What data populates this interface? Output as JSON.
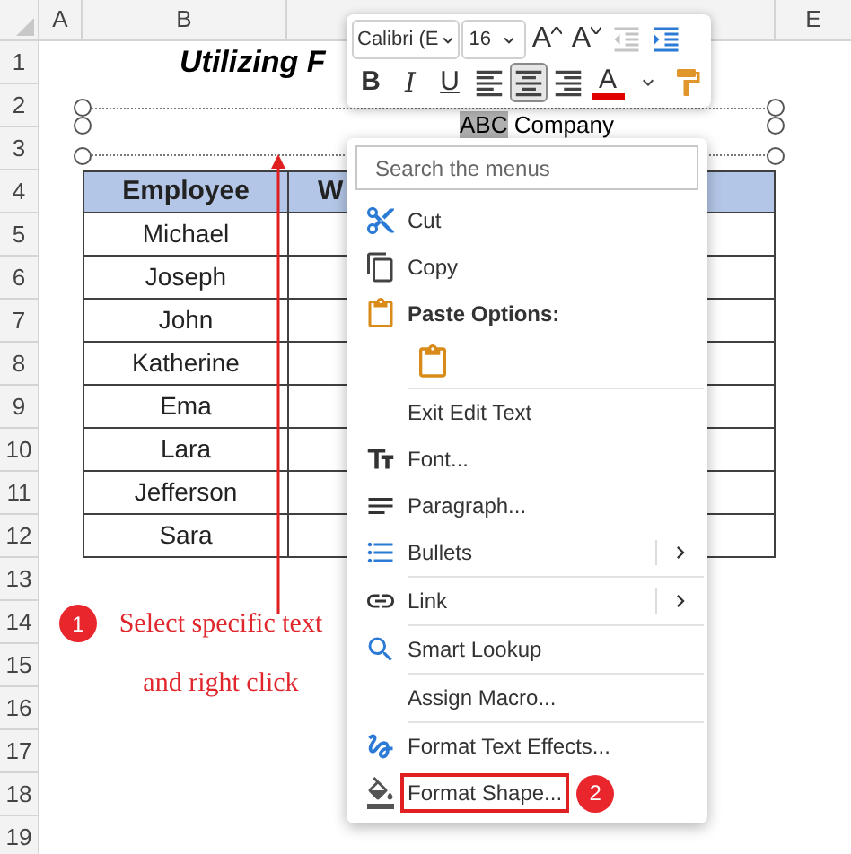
{
  "sheet": {
    "column_headers": [
      {
        "label": "A"
      },
      {
        "label": "B"
      },
      {
        "label": "E"
      }
    ],
    "row_headers": [
      "1",
      "2",
      "3",
      "4",
      "5",
      "6",
      "7",
      "8",
      "9",
      "10",
      "11",
      "12",
      "13",
      "14",
      "15",
      "16",
      "17",
      "18",
      "19"
    ],
    "title": "Utilizing F",
    "text_box": {
      "selected_text": "ABC",
      "rest_text": " Company"
    },
    "table": {
      "columns": [
        "Employee",
        "W"
      ],
      "rows": [
        "Michael",
        "Joseph",
        "John",
        "Katherine",
        "Ema",
        "Lara",
        "Jefferson",
        "Sara"
      ]
    }
  },
  "mini_toolbar": {
    "font": "Calibri (E",
    "size": "16",
    "row_1": [
      {
        "kind": "grow",
        "label": "A"
      },
      {
        "kind": "shrink",
        "label": "A"
      },
      {
        "kind": "indent-decrease",
        "disabled": true
      },
      {
        "kind": "indent-increase",
        "disabled": false
      }
    ],
    "row_2": [
      {
        "kind": "bold",
        "label": "B",
        "selected": false
      },
      {
        "kind": "italic",
        "label": "I",
        "selected": false
      },
      {
        "kind": "underline",
        "label": "U",
        "selected": false
      },
      {
        "kind": "align-left",
        "selected": false
      },
      {
        "kind": "align-center",
        "selected": true
      },
      {
        "kind": "align-right",
        "selected": false
      },
      {
        "kind": "font-color",
        "label": "A"
      },
      {
        "kind": "dropdown"
      },
      {
        "kind": "format-painter"
      }
    ]
  },
  "context_menu": {
    "search_placeholder": "Search the menus",
    "items": [
      {
        "kind": "cut",
        "label": "Cut",
        "separator_before": false,
        "submenu": false,
        "boxed": false
      },
      {
        "kind": "copy",
        "label": "Copy",
        "separator_before": false,
        "submenu": false,
        "boxed": false
      },
      {
        "kind": "paste-header",
        "label": "Paste Options:",
        "separator_before": false,
        "submenu": false,
        "boxed": false
      },
      {
        "kind": "paste-text",
        "separator_before": false
      },
      {
        "kind": "plain",
        "label": "Exit Edit Text",
        "separator_before": true,
        "submenu": false,
        "boxed": false
      },
      {
        "kind": "font",
        "label": "Font...",
        "separator_before": false,
        "submenu": false,
        "boxed": false
      },
      {
        "kind": "paragraph",
        "label": "Paragraph...",
        "separator_before": false,
        "submenu": false,
        "boxed": false
      },
      {
        "kind": "bullets",
        "label": "Bullets",
        "separator_before": false,
        "submenu": true,
        "boxed": false
      },
      {
        "kind": "link",
        "label": "Link",
        "separator_before": true,
        "submenu": true,
        "boxed": false
      },
      {
        "kind": "lookup",
        "label": "Smart Lookup",
        "separator_before": true,
        "submenu": false,
        "boxed": false
      },
      {
        "kind": "plain",
        "label": "Assign Macro...",
        "separator_before": true,
        "submenu": false,
        "boxed": false
      },
      {
        "kind": "text-effects",
        "label": "Format Text Effects...",
        "separator_before": true,
        "submenu": false,
        "boxed": false
      },
      {
        "kind": "format-shape",
        "label": "Format Shape...",
        "separator_before": false,
        "submenu": false,
        "boxed": true
      }
    ]
  },
  "annotations": [
    {
      "number": "1",
      "lines": [
        "Select specific text",
        "and right click"
      ]
    },
    {
      "number": "2"
    }
  ]
}
